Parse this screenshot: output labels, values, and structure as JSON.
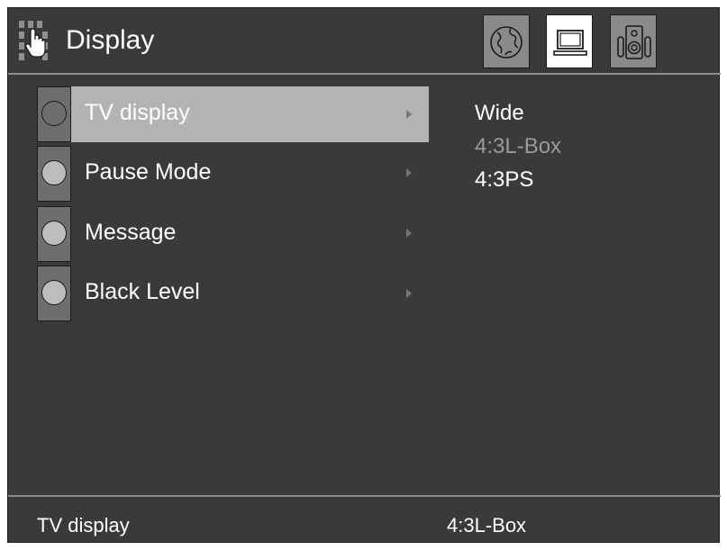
{
  "header": {
    "title": "Display",
    "tabs": [
      {
        "icon": "globe-icon",
        "active": false
      },
      {
        "icon": "monitor-icon",
        "active": true
      },
      {
        "icon": "speaker-icon",
        "active": false
      }
    ]
  },
  "menu": {
    "items": [
      {
        "label": "TV display",
        "selected": true
      },
      {
        "label": "Pause Mode",
        "selected": false
      },
      {
        "label": "Message",
        "selected": false
      },
      {
        "label": "Black Level",
        "selected": false
      }
    ]
  },
  "options": [
    {
      "label": "Wide",
      "state": "normal"
    },
    {
      "label": "4:3L-Box",
      "state": "dimmed"
    },
    {
      "label": "4:3PS",
      "state": "normal"
    }
  ],
  "status": {
    "label": "TV display",
    "value": "4:3L-Box"
  },
  "colors": {
    "background": "#3a3a3a",
    "highlight": "#b3b3b3",
    "separator": "#8c8c8c",
    "text": "#ffffff",
    "dim_text": "#9a9a9a"
  }
}
